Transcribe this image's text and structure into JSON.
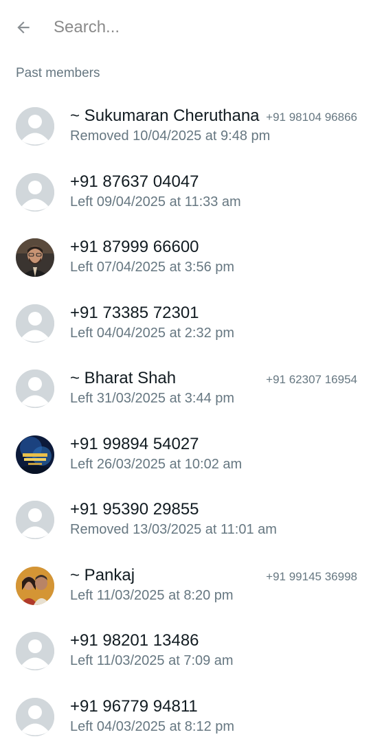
{
  "search": {
    "placeholder": "Search...",
    "value": ""
  },
  "section": {
    "title": "Past members"
  },
  "members": [
    {
      "name": "~ Sukumaran Cheruthana",
      "phone": "+91 98104 96866",
      "status": "Removed 10/04/2025 at 9:48 pm",
      "avatar": "default"
    },
    {
      "name": "+91 87637 04047",
      "phone": "",
      "status": "Left 09/04/2025 at 11:33 am",
      "avatar": "default"
    },
    {
      "name": "+91 87999 66600",
      "phone": "",
      "status": "Left 07/04/2025 at 3:56 pm",
      "avatar": "photo-man"
    },
    {
      "name": "+91 73385 72301",
      "phone": "",
      "status": "Left 04/04/2025 at 2:32 pm",
      "avatar": "default"
    },
    {
      "name": "~ Bharat Shah",
      "phone": "+91 62307 16954",
      "status": "Left 31/03/2025 at 3:44 pm",
      "avatar": "default"
    },
    {
      "name": "+91 99894 54027",
      "phone": "",
      "status": "Left 26/03/2025 at 10:02 am",
      "avatar": "photo-blue"
    },
    {
      "name": "+91 95390 29855",
      "phone": "",
      "status": "Removed 13/03/2025 at 11:01 am",
      "avatar": "default"
    },
    {
      "name": "~ Pankaj",
      "phone": "+91 99145 36998",
      "status": "Left 11/03/2025 at 8:20 pm",
      "avatar": "photo-couple"
    },
    {
      "name": "+91 98201 13486",
      "phone": "",
      "status": "Left 11/03/2025 at 7:09 am",
      "avatar": "default"
    },
    {
      "name": "+91 96779 94811",
      "phone": "",
      "status": "Left 04/03/2025 at 8:12 pm",
      "avatar": "default"
    }
  ],
  "colors": {
    "primary_text": "#111b21",
    "secondary_text": "#667781",
    "avatar_bg": "#d1d7db",
    "background": "#ffffff"
  },
  "icons": {
    "back": "arrow-back-icon",
    "default_avatar": "person-icon"
  }
}
